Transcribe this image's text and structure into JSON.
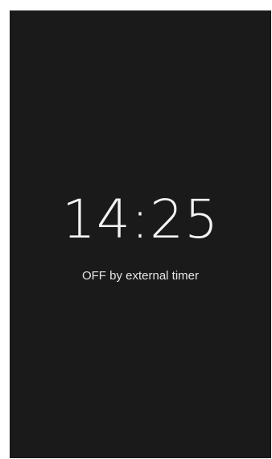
{
  "screen": {
    "background_color": "#1a1a1a",
    "time": "14:25",
    "status_message": "OFF by external timer"
  }
}
